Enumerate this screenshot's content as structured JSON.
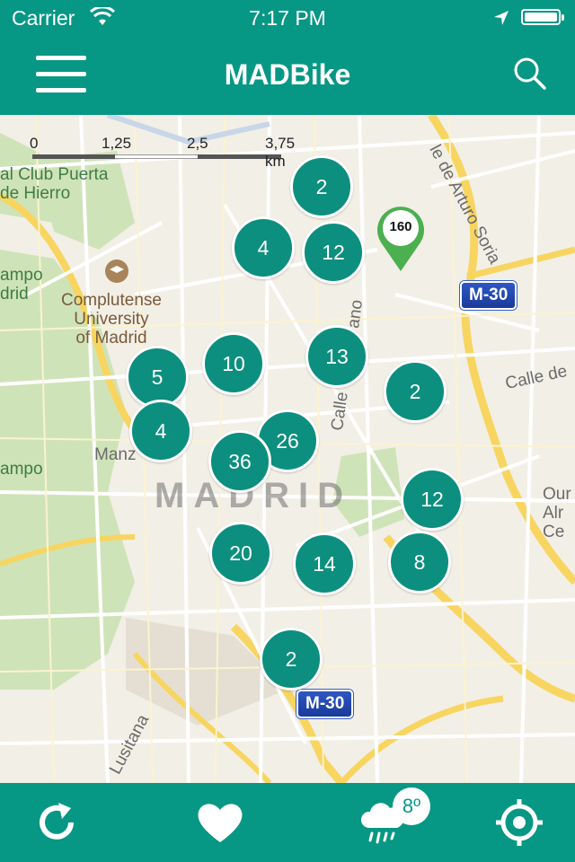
{
  "status_bar": {
    "carrier": "Carrier",
    "time": "7:17 PM"
  },
  "nav": {
    "title": "MADBike"
  },
  "map": {
    "scale": {
      "ticks": [
        "0",
        "1,25",
        "2,5",
        "3,75 km"
      ]
    },
    "labels": {
      "club": "al Club Puerta\nde Hierro",
      "university": "Complutense\nUniversity\nof Madrid",
      "campo1": "ampo\ndrid",
      "campo2": "ampo",
      "manz": "Manz",
      "city": "MADRID",
      "arturo": "le de Arturo Soria",
      "calle_de": "Calle de",
      "calle_vert": "Calle",
      "ano": "ano",
      "ourense": "Our\nAlr\nCe",
      "lusitana": "Lusitana"
    },
    "road_badges": [
      "M-30",
      "M-30"
    ],
    "clusters": [
      "2",
      "4",
      "12",
      "10",
      "13",
      "5",
      "2",
      "4",
      "26",
      "36",
      "12",
      "20",
      "14",
      "8",
      "2"
    ],
    "pin_count": "160"
  },
  "weather": {
    "temperature": "8º"
  },
  "colors": {
    "primary": "#079785",
    "cluster": "#0c8f7e",
    "pin": "#4caf50"
  }
}
